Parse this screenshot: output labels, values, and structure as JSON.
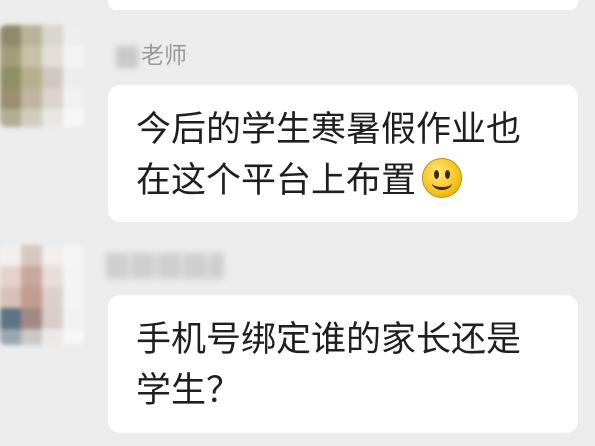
{
  "chat": {
    "messages": [
      {
        "sender_suffix": "老师",
        "lines": [
          "今后的学生寒暑假作业也",
          "在这个平台上布置"
        ],
        "emoji": "smile-icon"
      },
      {
        "sender_suffix": "",
        "lines": [
          "手机号绑定谁的家长还是",
          "学生？"
        ]
      }
    ]
  },
  "colors": {
    "background": "#ececec",
    "bubble": "#ffffff",
    "sender_text": "#9a9a9a",
    "message_text": "#1f1f1f"
  },
  "avatars": {
    "first": [
      "#8e8a6a",
      "#b9b39a",
      "#d9d6cf",
      "#eeeeee",
      "#a29d78",
      "#c7c1a7",
      "#e2ded7",
      "#f3f3f3",
      "#8f8f64",
      "#b7af8d",
      "#d0c7c1",
      "#ededed",
      "#9b8f70",
      "#bfb4a0",
      "#dcd3cc",
      "#f1f1f1",
      "#b3ad93",
      "#d1ccc0",
      "#e9e7e3",
      "#f6f6f6"
    ],
    "second": [
      "#f3efed",
      "#d8c7c1",
      "#f2eeeb",
      "#f5f5f5",
      "#e5d2cc",
      "#c8a79d",
      "#e8ddd9",
      "#f4f4f4",
      "#d7c0b6",
      "#c29c8f",
      "#ddd0cb",
      "#f3f3f3",
      "#5e7386",
      "#a08a86",
      "#d8cdca",
      "#f2f2f2",
      "#9aa7b1",
      "#cbc7c5",
      "#ebe9e8",
      "#f6f6f6"
    ]
  }
}
